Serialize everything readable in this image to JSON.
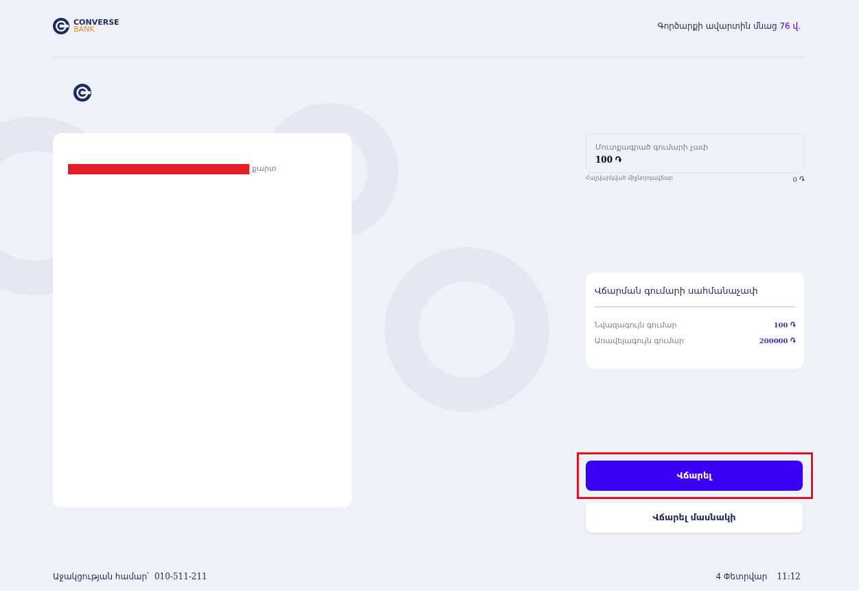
{
  "header": {
    "logo": {
      "name": "CONVERSE",
      "sub": "BANK"
    },
    "session": {
      "text": "Գործարքի ավարտին մնաց",
      "time": "76 վ."
    }
  },
  "receipt": {
    "line_label": "քարտ"
  },
  "amount_field": {
    "label": "Մուտքագրած գումարի չափ",
    "value": "100 ֏"
  },
  "commission": {
    "label": "Հաշվարկված միջնորդավճար",
    "value": "0 ֏"
  },
  "limits": {
    "title": "Վճարման գումարի սահմանաչափ",
    "rows": [
      {
        "label": "Նվազագույն գումար",
        "value": "100 ֏"
      },
      {
        "label": "Առավելագույն գումար",
        "value": "200000 ֏"
      }
    ]
  },
  "buttons": [
    {
      "label": "Վճարել",
      "kind": "primary",
      "highlighted": true
    },
    {
      "label": "Վճարել մասնակի",
      "kind": "secondary",
      "highlighted": false
    }
  ],
  "footer": {
    "support_label": "Աջակցության համար՝",
    "phone": "010-511-211",
    "date": "4 Փետրվար",
    "time": "11:12"
  }
}
